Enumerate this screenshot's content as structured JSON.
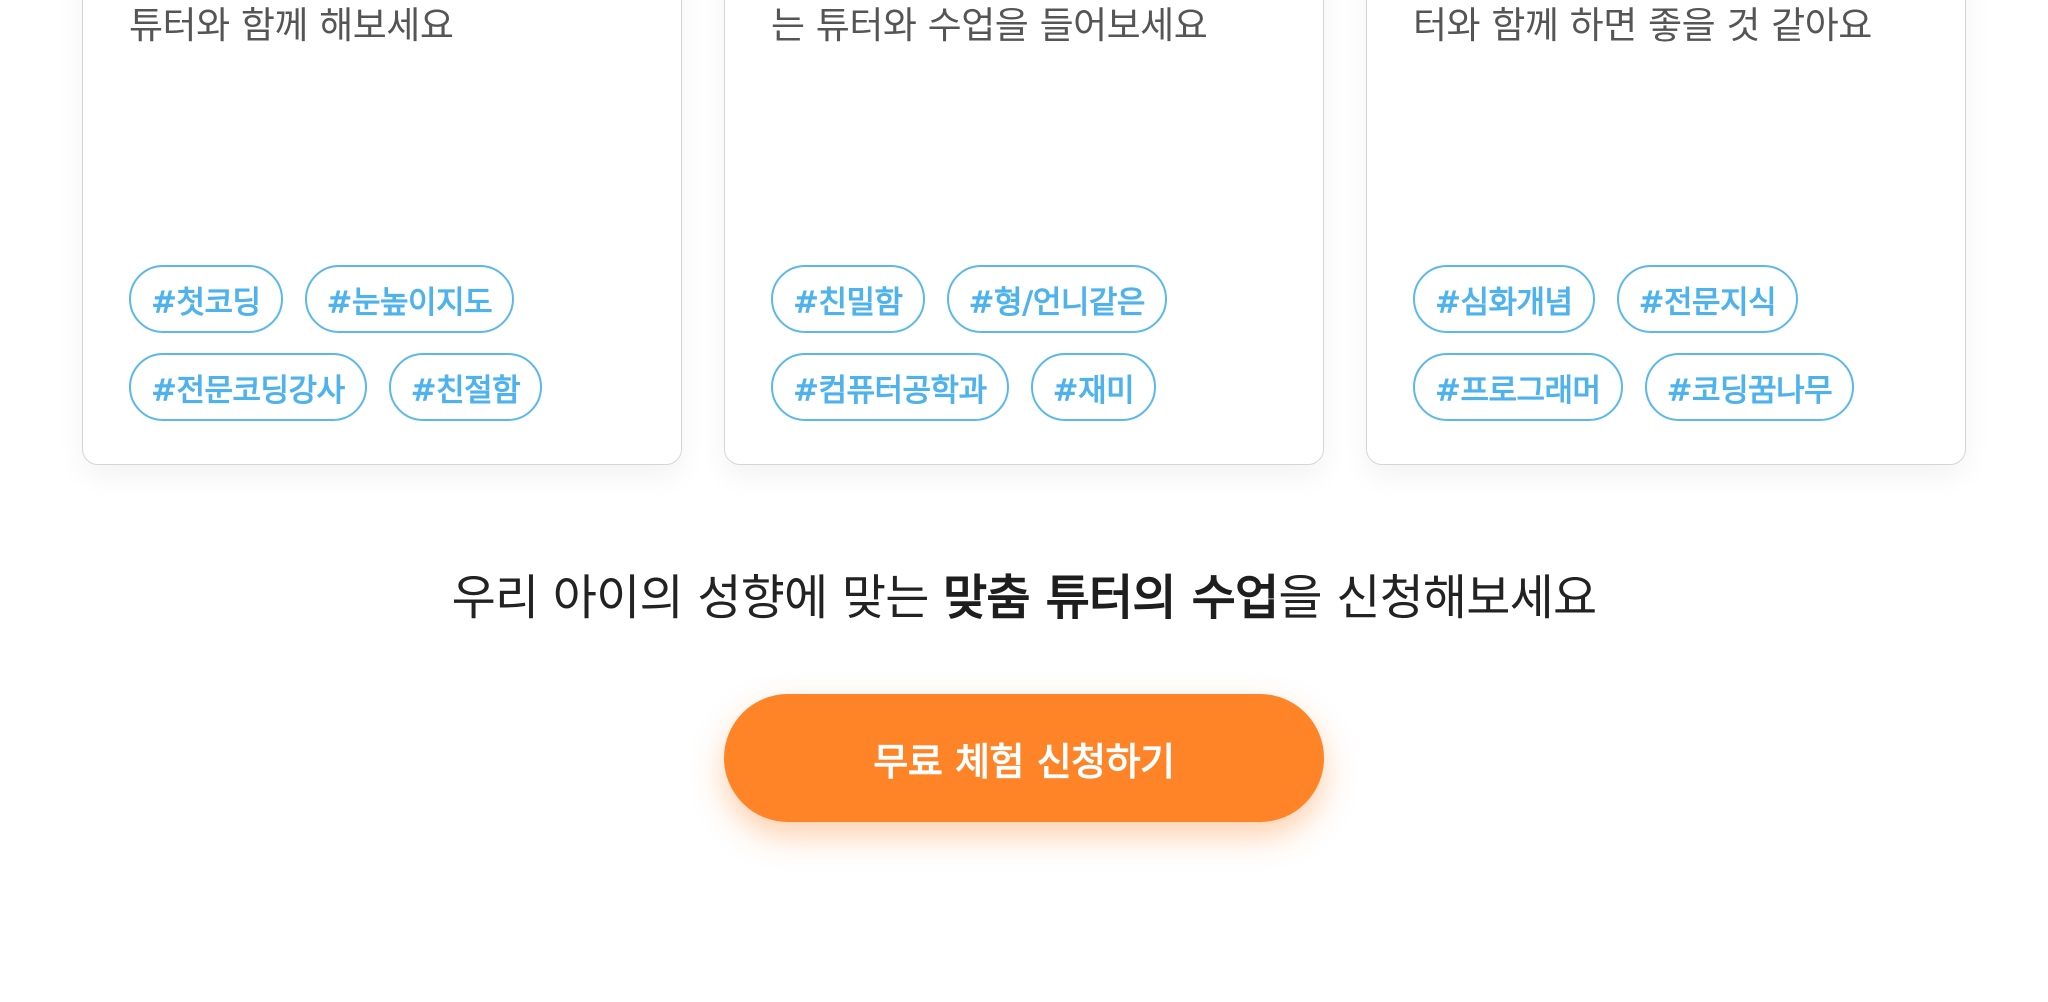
{
  "cards": [
    {
      "description": "튜터와 함께 해보세요",
      "tag_rows": [
        [
          "#첫코딩",
          "#눈높이지도"
        ],
        [
          "#전문코딩강사",
          "#친절함"
        ]
      ]
    },
    {
      "description": "는 튜터와 수업을 들어보세요",
      "tag_rows": [
        [
          "#친밀함",
          "#형/언니같은"
        ],
        [
          "#컴퓨터공학과",
          "#재미"
        ]
      ]
    },
    {
      "description": "터와 함께 하면 좋을 것 같아요",
      "tag_rows": [
        [
          "#심화개념",
          "#전문지식"
        ],
        [
          "#프로그래머",
          "#코딩꿈나무"
        ]
      ]
    }
  ],
  "cta": {
    "text_before": "우리 아이의 성향에 맞는 ",
    "text_bold": "맞춤 튜터의 수업",
    "text_after": "을 신청해보세요",
    "button_label": "무료 체험 신청하기"
  },
  "colors": {
    "tag_accent": "#4eb2ec",
    "button_bg": "#ff8428",
    "card_border": "#d6d6d6"
  }
}
